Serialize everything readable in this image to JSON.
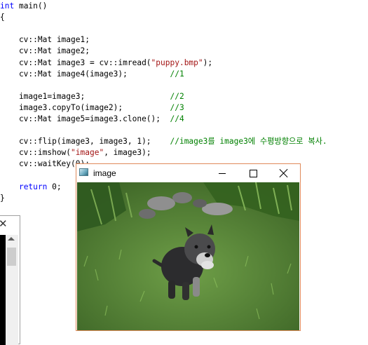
{
  "editor": {
    "lines": [
      {
        "text": "",
        "segments": [
          {
            "t": "int",
            "c": "kw"
          },
          {
            "t": " main()",
            "c": ""
          }
        ]
      },
      {
        "segments": [
          {
            "t": "{",
            "c": ""
          }
        ]
      },
      {
        "segments": []
      },
      {
        "segments": [
          {
            "t": "    cv::Mat image1;",
            "c": ""
          }
        ]
      },
      {
        "segments": [
          {
            "t": "    cv::Mat image2;",
            "c": ""
          }
        ]
      },
      {
        "segments": [
          {
            "t": "    cv::Mat image3 = cv::imread(",
            "c": ""
          },
          {
            "t": "\"puppy.bmp\"",
            "c": "str"
          },
          {
            "t": ");",
            "c": ""
          }
        ]
      },
      {
        "segments": [
          {
            "t": "    cv::Mat image4(image3);         ",
            "c": ""
          },
          {
            "t": "//1",
            "c": "cm"
          }
        ]
      },
      {
        "segments": []
      },
      {
        "segments": [
          {
            "t": "    image1=image3;                  ",
            "c": ""
          },
          {
            "t": "//2",
            "c": "cm"
          }
        ]
      },
      {
        "segments": [
          {
            "t": "    image3.copyTo(image2);          ",
            "c": ""
          },
          {
            "t": "//3",
            "c": "cm"
          }
        ]
      },
      {
        "segments": [
          {
            "t": "    cv::Mat image5=image3.clone();  ",
            "c": ""
          },
          {
            "t": "//4",
            "c": "cm"
          }
        ]
      },
      {
        "segments": []
      },
      {
        "segments": [
          {
            "t": "    cv::flip(image3, image3, 1);    ",
            "c": ""
          },
          {
            "t": "//image3를 image3에 수평방향으로 복사.",
            "c": "cm"
          }
        ]
      },
      {
        "segments": [
          {
            "t": "    cv::imshow(",
            "c": ""
          },
          {
            "t": "\"image\"",
            "c": "str"
          },
          {
            "t": ", image3);",
            "c": ""
          }
        ]
      },
      {
        "segments": [
          {
            "t": "    cv::waitKey(0);",
            "c": ""
          }
        ]
      },
      {
        "segments": []
      },
      {
        "segments": [
          {
            "t": "    ",
            "c": ""
          },
          {
            "t": "return",
            "c": "kw"
          },
          {
            "t": " 0;",
            "c": ""
          }
        ]
      },
      {
        "segments": [
          {
            "t": "}",
            "c": ""
          }
        ]
      }
    ]
  },
  "image_window": {
    "title": "image",
    "icon": "app-window-icon",
    "minimize_icon": "minimize-icon",
    "maximize_icon": "maximize-icon",
    "close_icon": "close-icon",
    "border_color": "#e08a5a"
  },
  "console_window": {
    "close_icon": "close-icon",
    "close_glyph": "✕"
  },
  "colors": {
    "keyword": "#0000ff",
    "string": "#a31515",
    "comment": "#008000"
  }
}
